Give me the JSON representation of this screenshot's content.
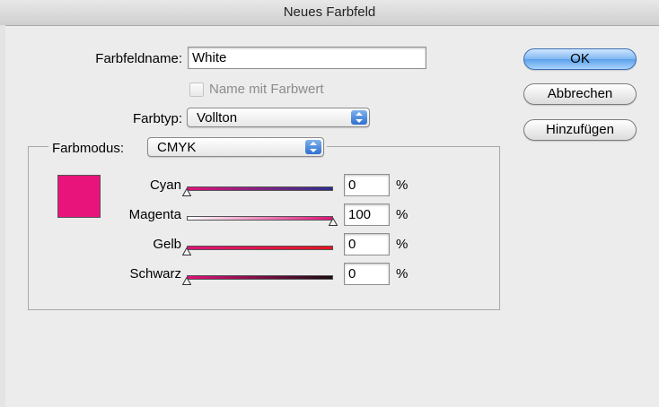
{
  "window": {
    "title": "Neues Farbfeld"
  },
  "form": {
    "name_label": "Farbfeldname:",
    "name_value": "White",
    "name_with_value_label": "Name mit Farbwert",
    "name_with_value_checked": false,
    "type_label": "Farbtyp:",
    "type_value": "Vollton",
    "mode_label": "Farbmodus:",
    "mode_value": "CMYK"
  },
  "buttons": {
    "ok": "OK",
    "cancel": "Abbrechen",
    "add": "Hinzufügen"
  },
  "swatch_color": "#e8147c",
  "sliders": [
    {
      "label": "Cyan",
      "value": "0",
      "unit": "%",
      "level": 0,
      "colors": [
        "#e0117a",
        "#2b2f8c"
      ]
    },
    {
      "label": "Magenta",
      "value": "100",
      "unit": "%",
      "level": 100,
      "colors": [
        "#ffffff",
        "#e0117a"
      ]
    },
    {
      "label": "Gelb",
      "value": "0",
      "unit": "%",
      "level": 0,
      "colors": [
        "#e0117a",
        "#e8141c"
      ]
    },
    {
      "label": "Schwarz",
      "value": "0",
      "unit": "%",
      "level": 0,
      "colors": [
        "#e0117a",
        "#1a0a10"
      ]
    }
  ]
}
